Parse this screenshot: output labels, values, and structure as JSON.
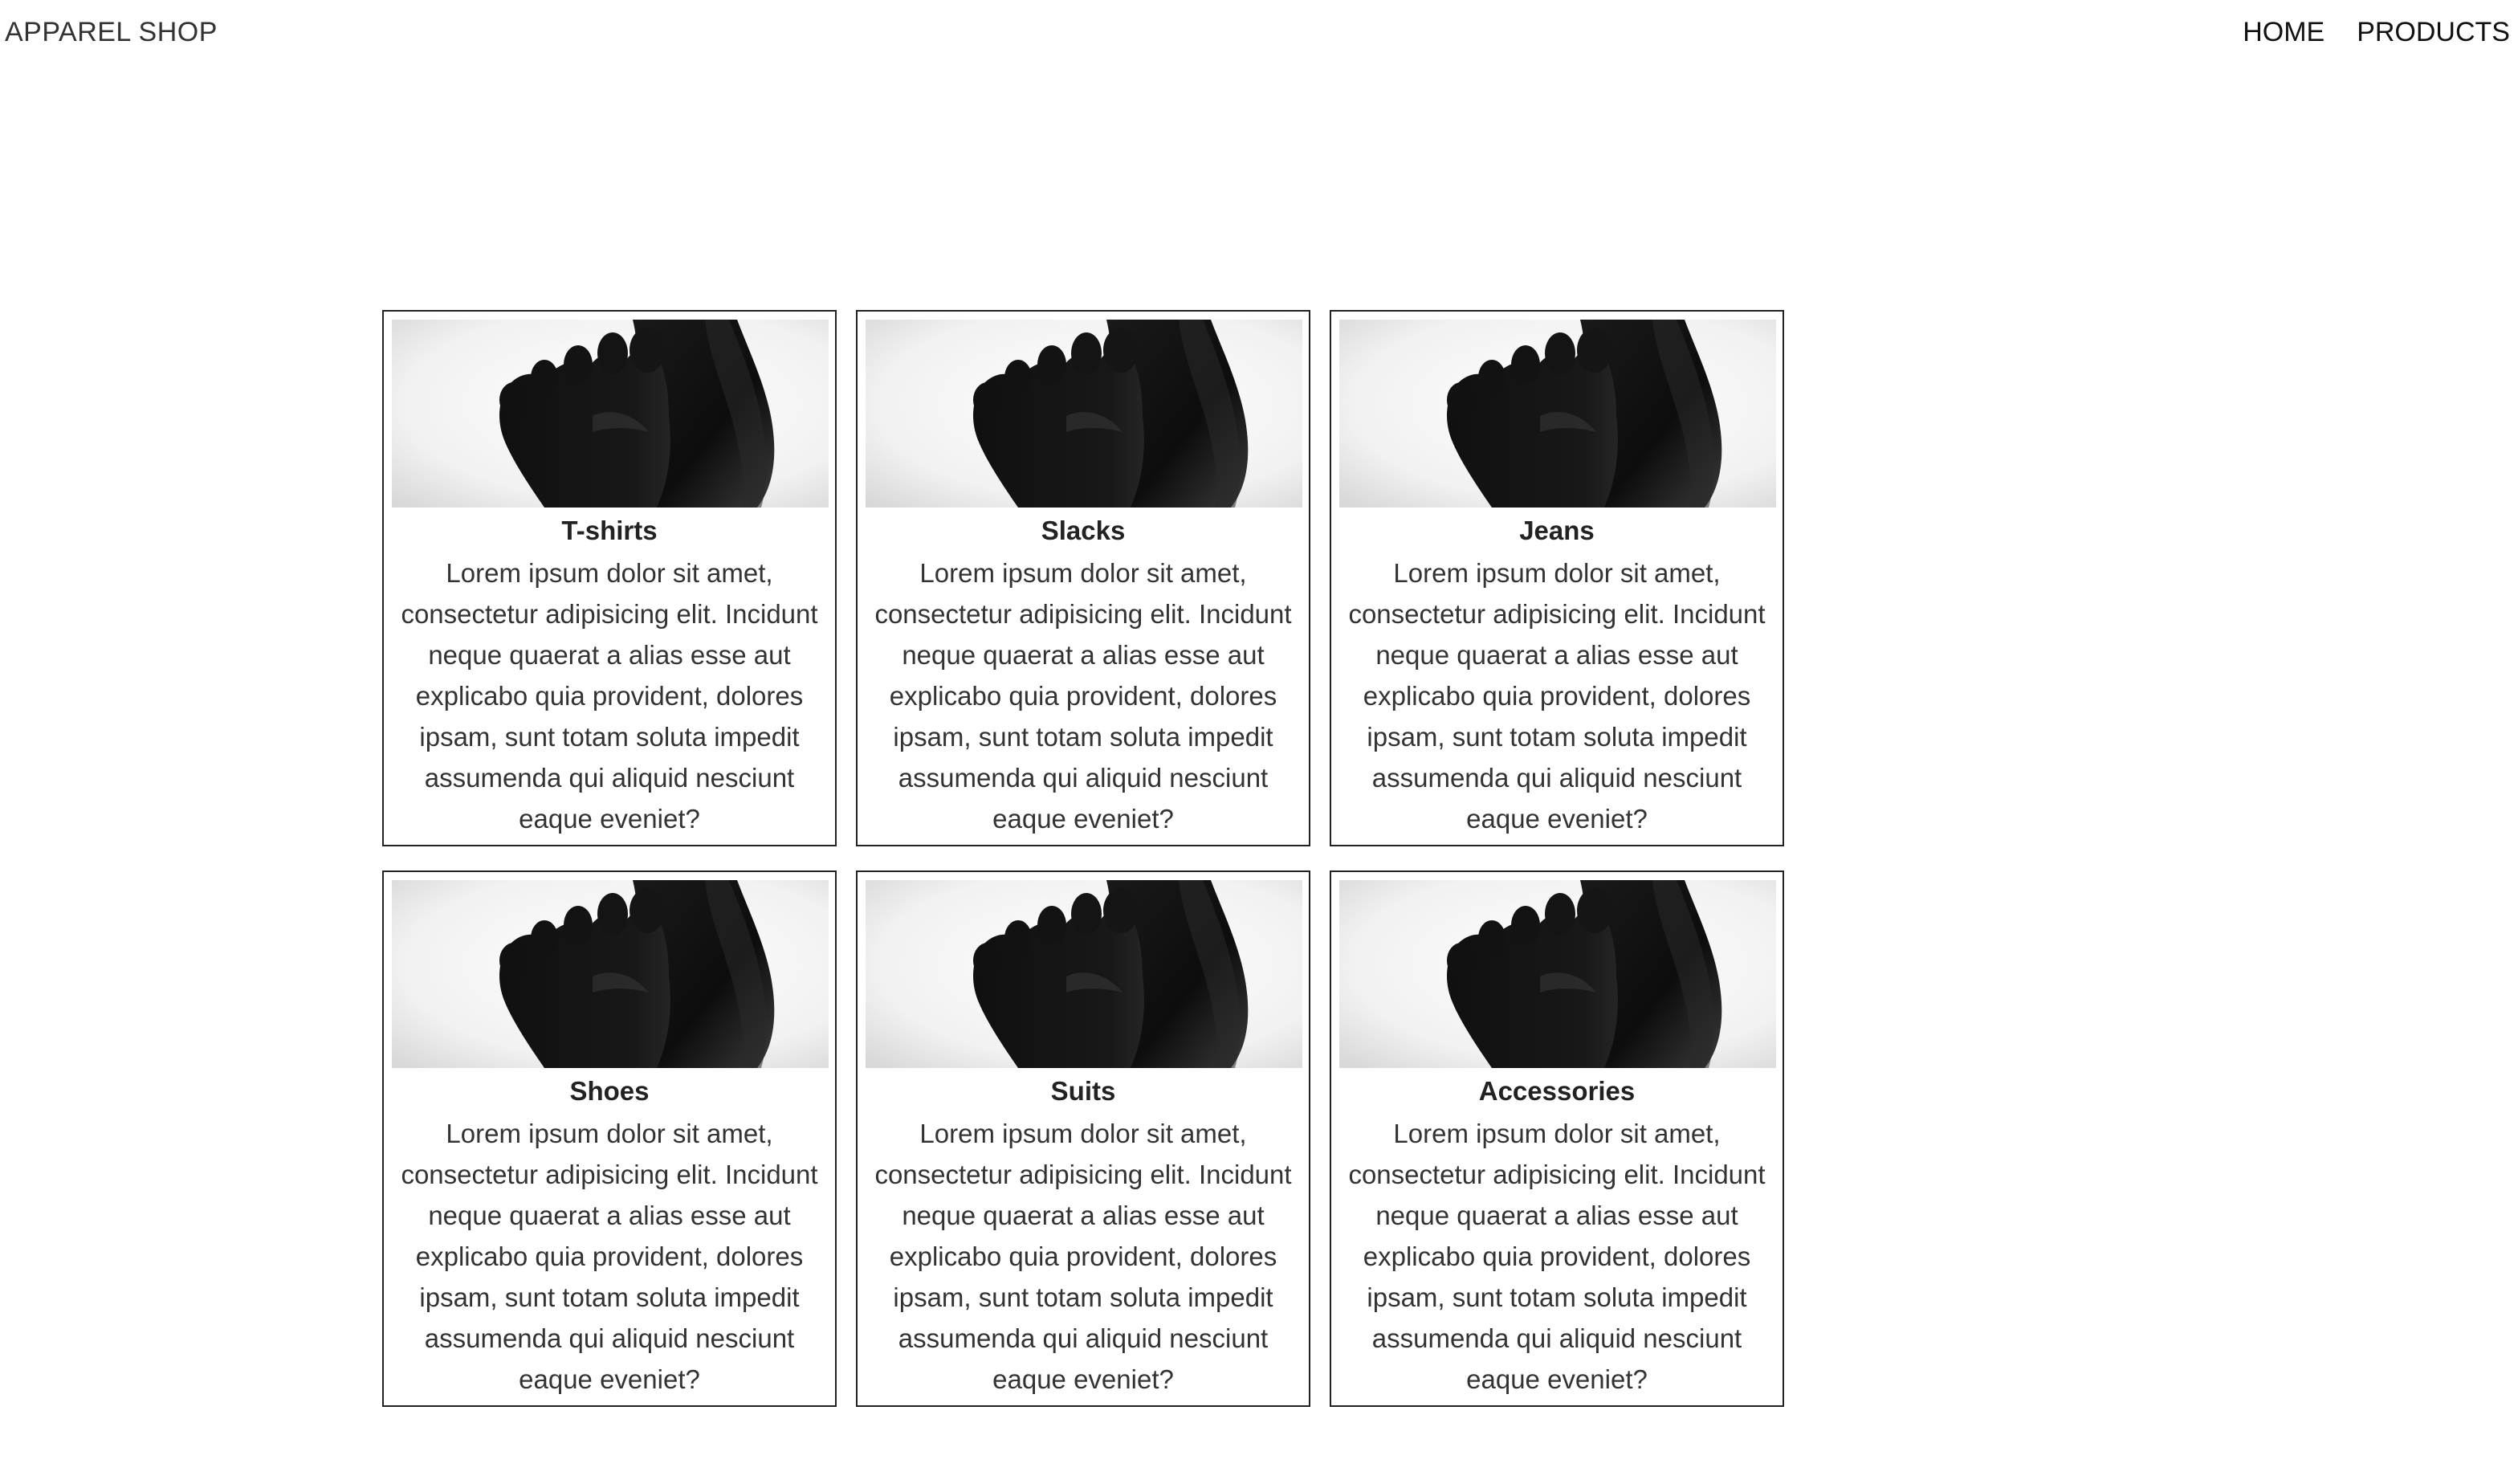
{
  "header": {
    "brand": "APPAREL SHOP",
    "nav": [
      {
        "label": "HOME"
      },
      {
        "label": "PRODUCTS"
      }
    ]
  },
  "products": [
    {
      "title": "T-shirts",
      "description": "Lorem ipsum dolor sit amet, consectetur adipisicing elit. Incidunt neque quaerat a alias esse aut explicabo quia provident, dolores ipsam, sunt totam soluta impedit assumenda qui aliquid nesciunt eaque eveniet?"
    },
    {
      "title": "Slacks",
      "description": "Lorem ipsum dolor sit amet, consectetur adipisicing elit. Incidunt neque quaerat a alias esse aut explicabo quia provident, dolores ipsam, sunt totam soluta impedit assumenda qui aliquid nesciunt eaque eveniet?"
    },
    {
      "title": "Jeans",
      "description": "Lorem ipsum dolor sit amet, consectetur adipisicing elit. Incidunt neque quaerat a alias esse aut explicabo quia provident, dolores ipsam, sunt totam soluta impedit assumenda qui aliquid nesciunt eaque eveniet?"
    },
    {
      "title": "Shoes",
      "description": "Lorem ipsum dolor sit amet, consectetur adipisicing elit. Incidunt neque quaerat a alias esse aut explicabo quia provident, dolores ipsam, sunt totam soluta impedit assumenda qui aliquid nesciunt eaque eveniet?"
    },
    {
      "title": "Suits",
      "description": "Lorem ipsum dolor sit amet, consectetur adipisicing elit. Incidunt neque quaerat a alias esse aut explicabo quia provident, dolores ipsam, sunt totam soluta impedit assumenda qui aliquid nesciunt eaque eveniet?"
    },
    {
      "title": "Accessories",
      "description": "Lorem ipsum dolor sit amet, consectetur adipisicing elit. Incidunt neque quaerat a alias esse aut explicabo quia provident, dolores ipsam, sunt totam soluta impedit assumenda qui aliquid nesciunt eaque eveniet?"
    }
  ]
}
